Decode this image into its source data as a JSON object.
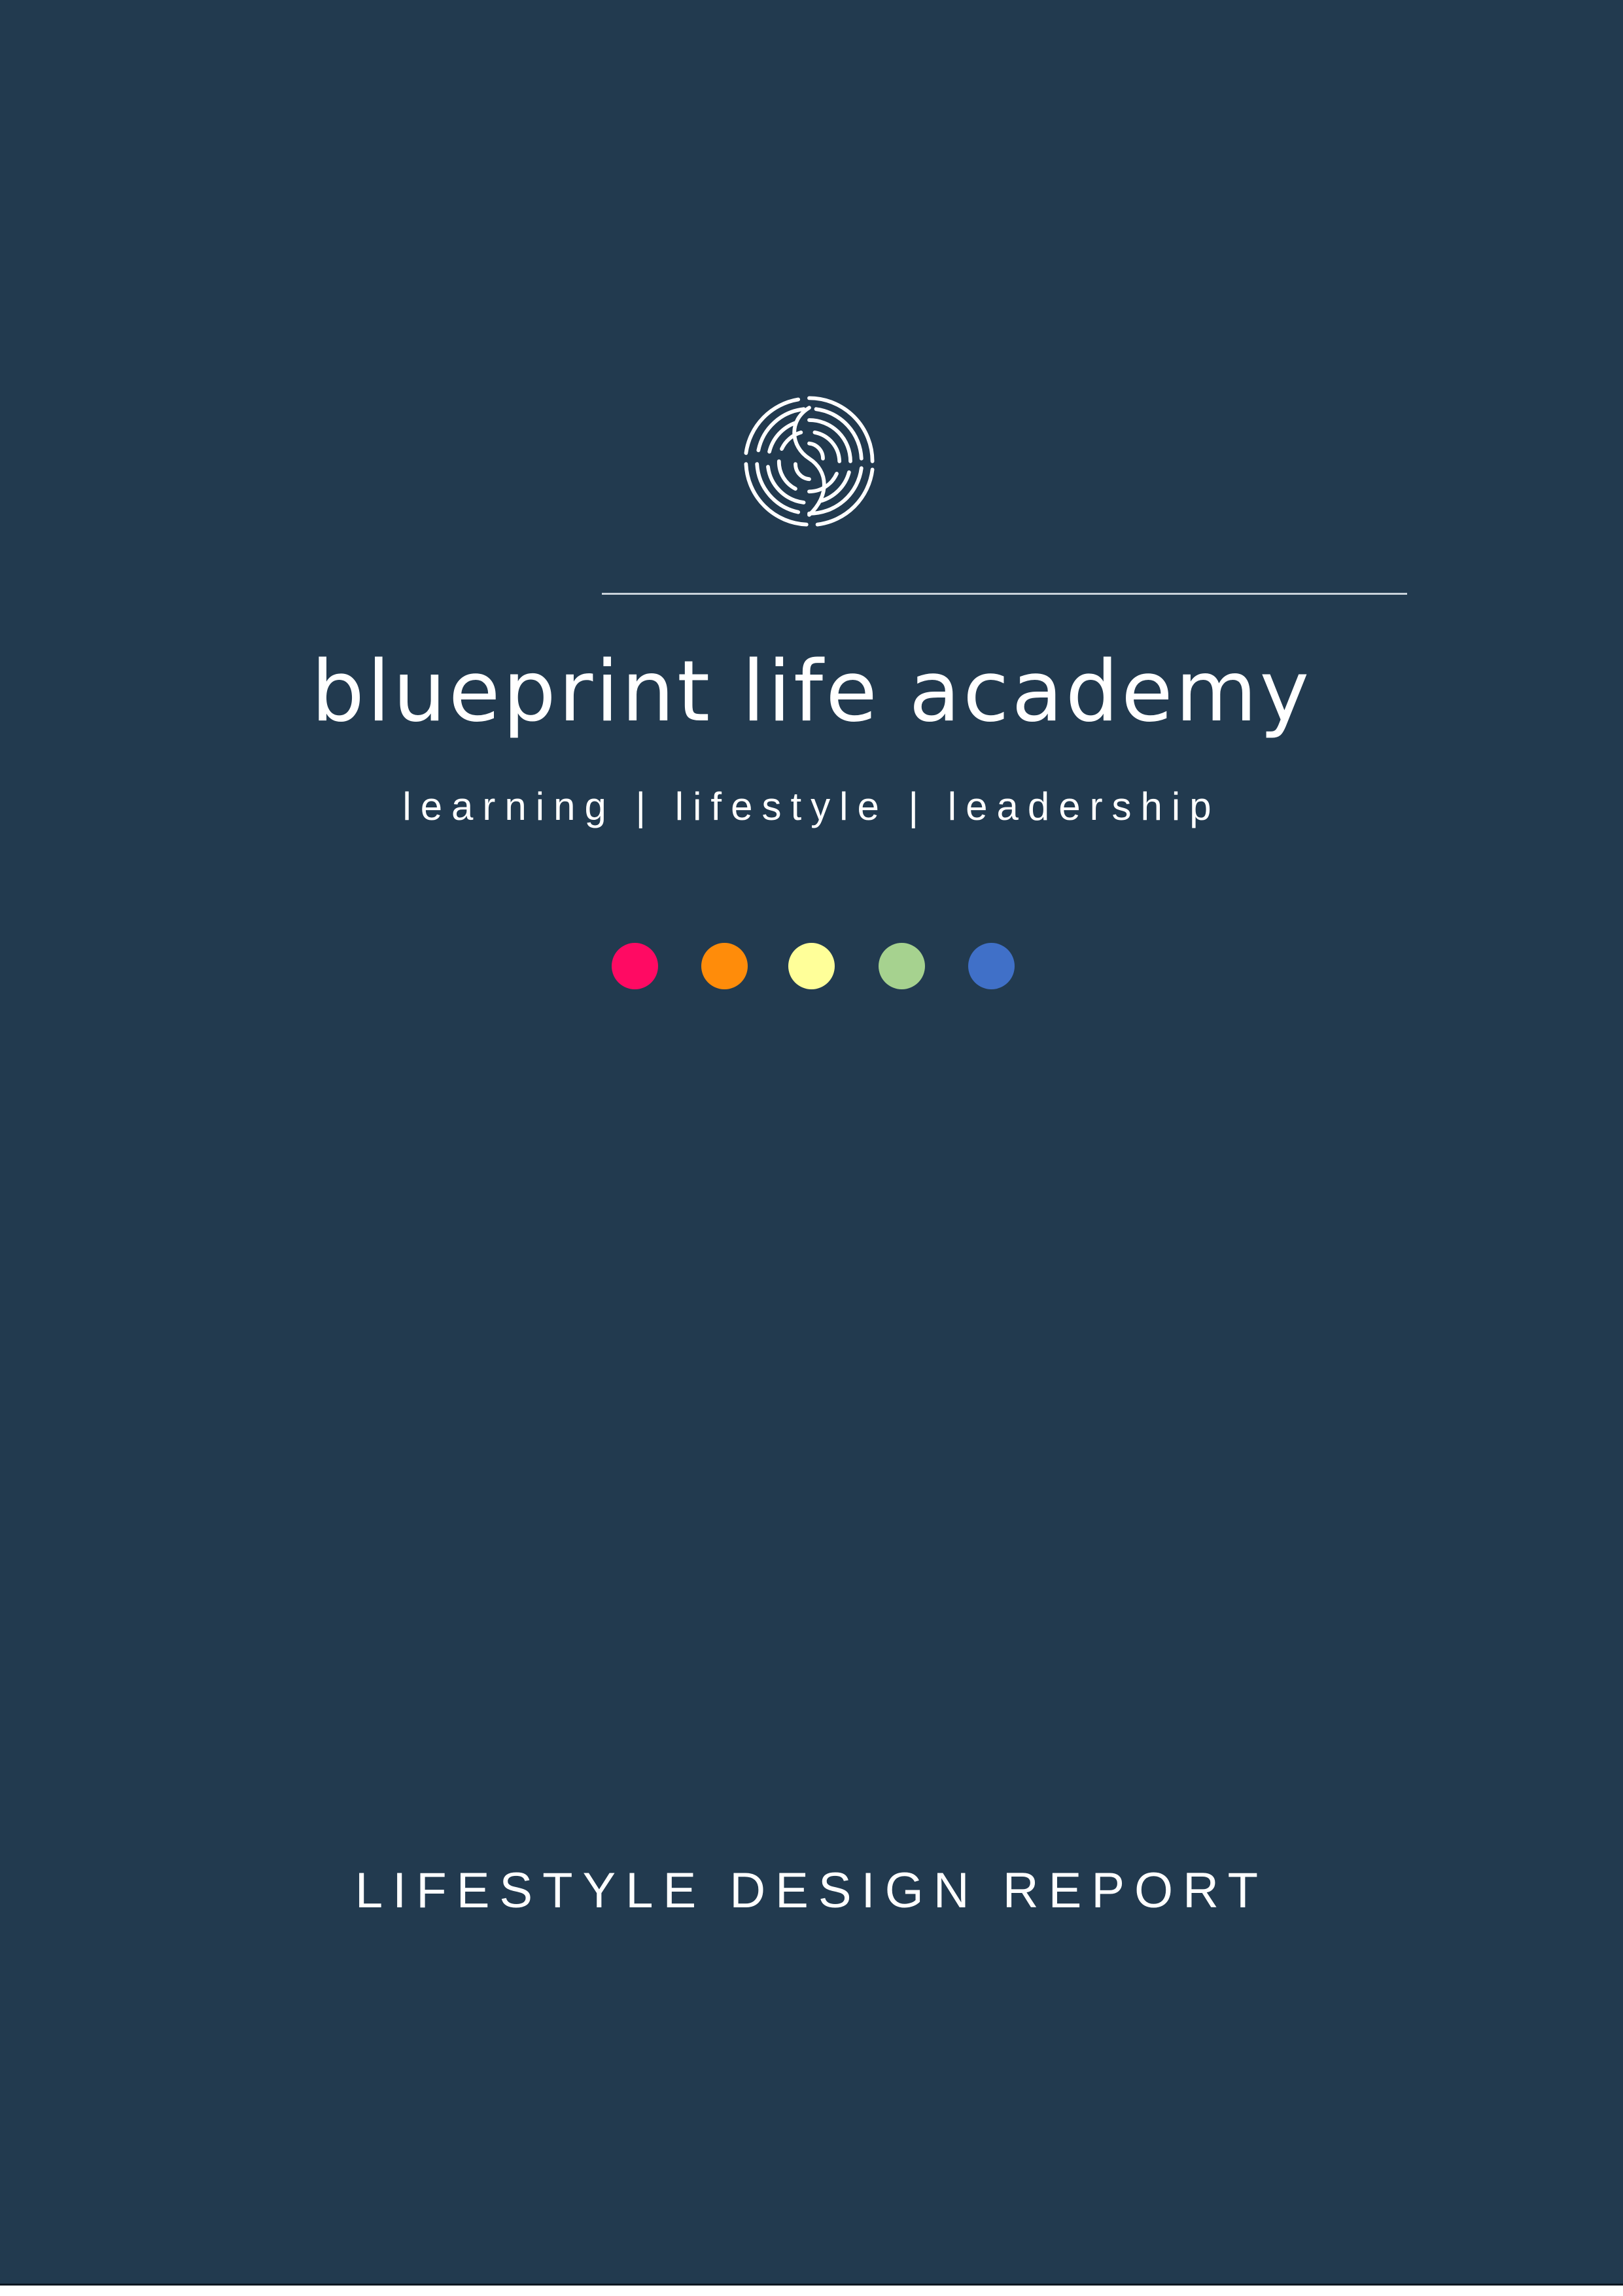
{
  "brand": {
    "name": "blueprint life academy",
    "tagline": "learning | lifestyle | leadership",
    "logo_icon": "fingerprint-spiral-icon"
  },
  "palette": {
    "background": "#223a4f",
    "text": "#ffffff",
    "dots": [
      "#ff0a63",
      "#ff8c0a",
      "#ffff99",
      "#a6d28f",
      "#4070c8"
    ]
  },
  "report": {
    "title": "LIFESTYLE DESIGN REPORT"
  }
}
